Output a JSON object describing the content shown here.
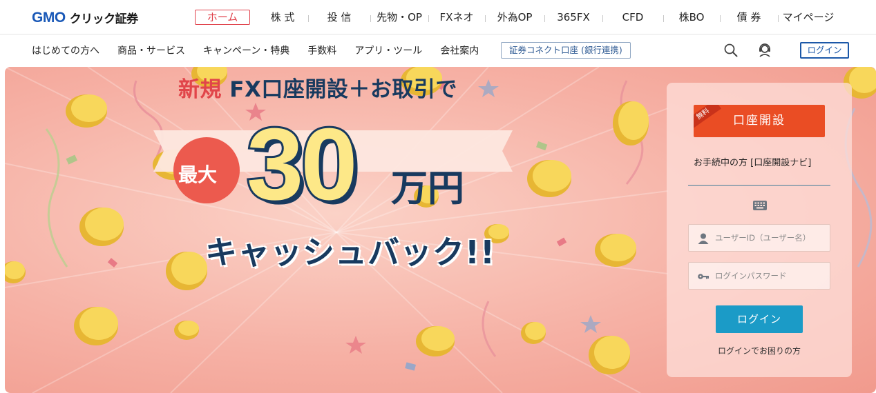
{
  "brand": {
    "logo_gmo": "GMO",
    "logo_rest": "クリック証券"
  },
  "topnav": {
    "items": [
      {
        "label": "ホーム",
        "active": true
      },
      {
        "label": "株 式"
      },
      {
        "label": "投 信"
      },
      {
        "label": "先物・OP"
      },
      {
        "label": "FXネオ"
      },
      {
        "label": "外為OP"
      },
      {
        "label": "365FX"
      },
      {
        "label": "CFD"
      },
      {
        "label": "株BO"
      },
      {
        "label": "債 券"
      },
      {
        "label": "マイページ"
      }
    ]
  },
  "subnav": {
    "items": [
      "はじめての方へ",
      "商品・サービス",
      "キャンペーン・特典",
      "手数料",
      "アプリ・ツール",
      "会社案内"
    ],
    "connect_label": "証券コネクト口座 (銀行連携)",
    "login_label": "ログイン",
    "icons": [
      "search-icon",
      "support-icon"
    ]
  },
  "hero": {
    "line1_red": "新規",
    "line1_rest": " FX口座開設＋お取引で",
    "max_label": "最大",
    "amount": "30",
    "unit": "万円",
    "cashback": "キャッシュバック!!",
    "colors": {
      "navy": "#183a5f",
      "red": "#e1454a",
      "gold": "#fde888"
    }
  },
  "login_panel": {
    "free_tag": "無料",
    "open_account_label": "口座開設",
    "navi_link": "お手続中の方 [口座開設ナビ]",
    "user_placeholder": "ユーザーID（ユーザー名）",
    "password_placeholder": "ログインパスワード",
    "login_label": "ログイン",
    "trouble_link": "ログインでお困りの方",
    "colors": {
      "open_account": "#ea4d24",
      "login": "#1b9bc7"
    }
  }
}
